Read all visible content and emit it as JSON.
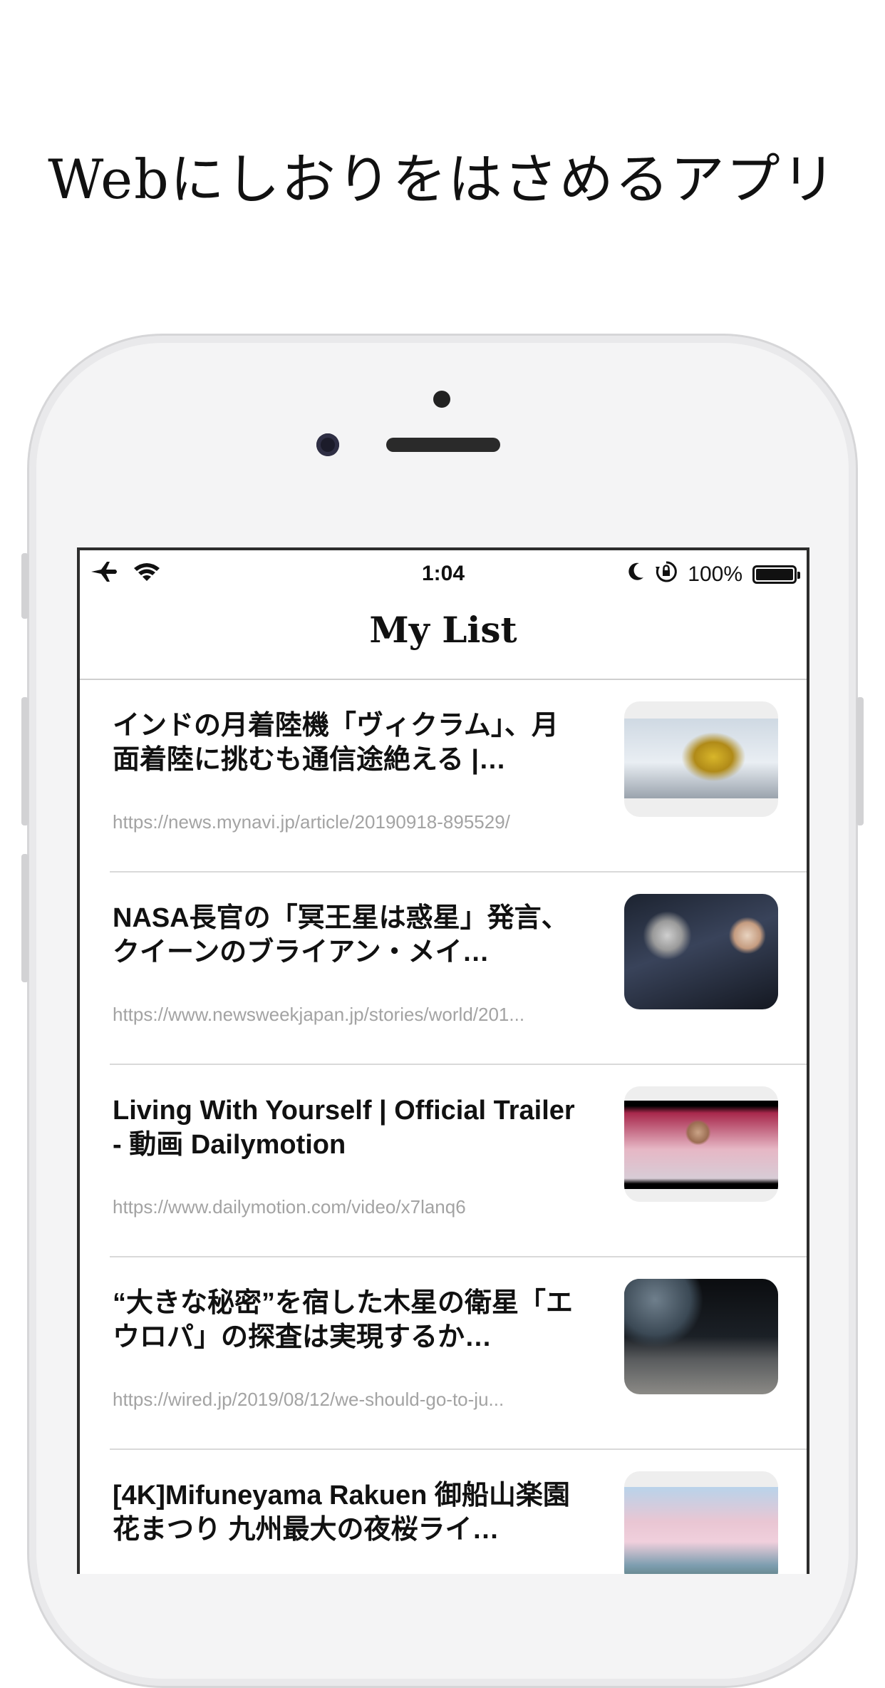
{
  "headline": "Webにしおりをはさめるアプリ",
  "status_bar": {
    "time": "1:04",
    "battery": "100%",
    "icons": [
      "airplane-icon",
      "wifi-icon",
      "moon-icon",
      "rotation-lock-icon",
      "battery-icon"
    ]
  },
  "nav": {
    "title": "My List"
  },
  "items": [
    {
      "title": "インドの月着陸機「ヴィクラム」、月面着陸に挑むも通信途絶える |…",
      "url": "https://news.mynavi.jp/article/20190918-895529/"
    },
    {
      "title": "NASA長官の「冥王星は惑星」発言、クイーンのブライアン・メイ…",
      "url": "https://www.newsweekjapan.jp/stories/world/201..."
    },
    {
      "title": "Living With Yourself | Official Trailer - 動画 Dailymotion",
      "url": "https://www.dailymotion.com/video/x7lanq6"
    },
    {
      "title": "“大きな秘密”を宿した木星の衛星「エウロパ」の探査は実現するか…",
      "url": "https://wired.jp/2019/08/12/we-should-go-to-ju..."
    },
    {
      "title": "[4K]Mifuneyama Rakuen 御船山楽園 花まつり 九州最大の夜桜ライ…",
      "url": ""
    }
  ]
}
